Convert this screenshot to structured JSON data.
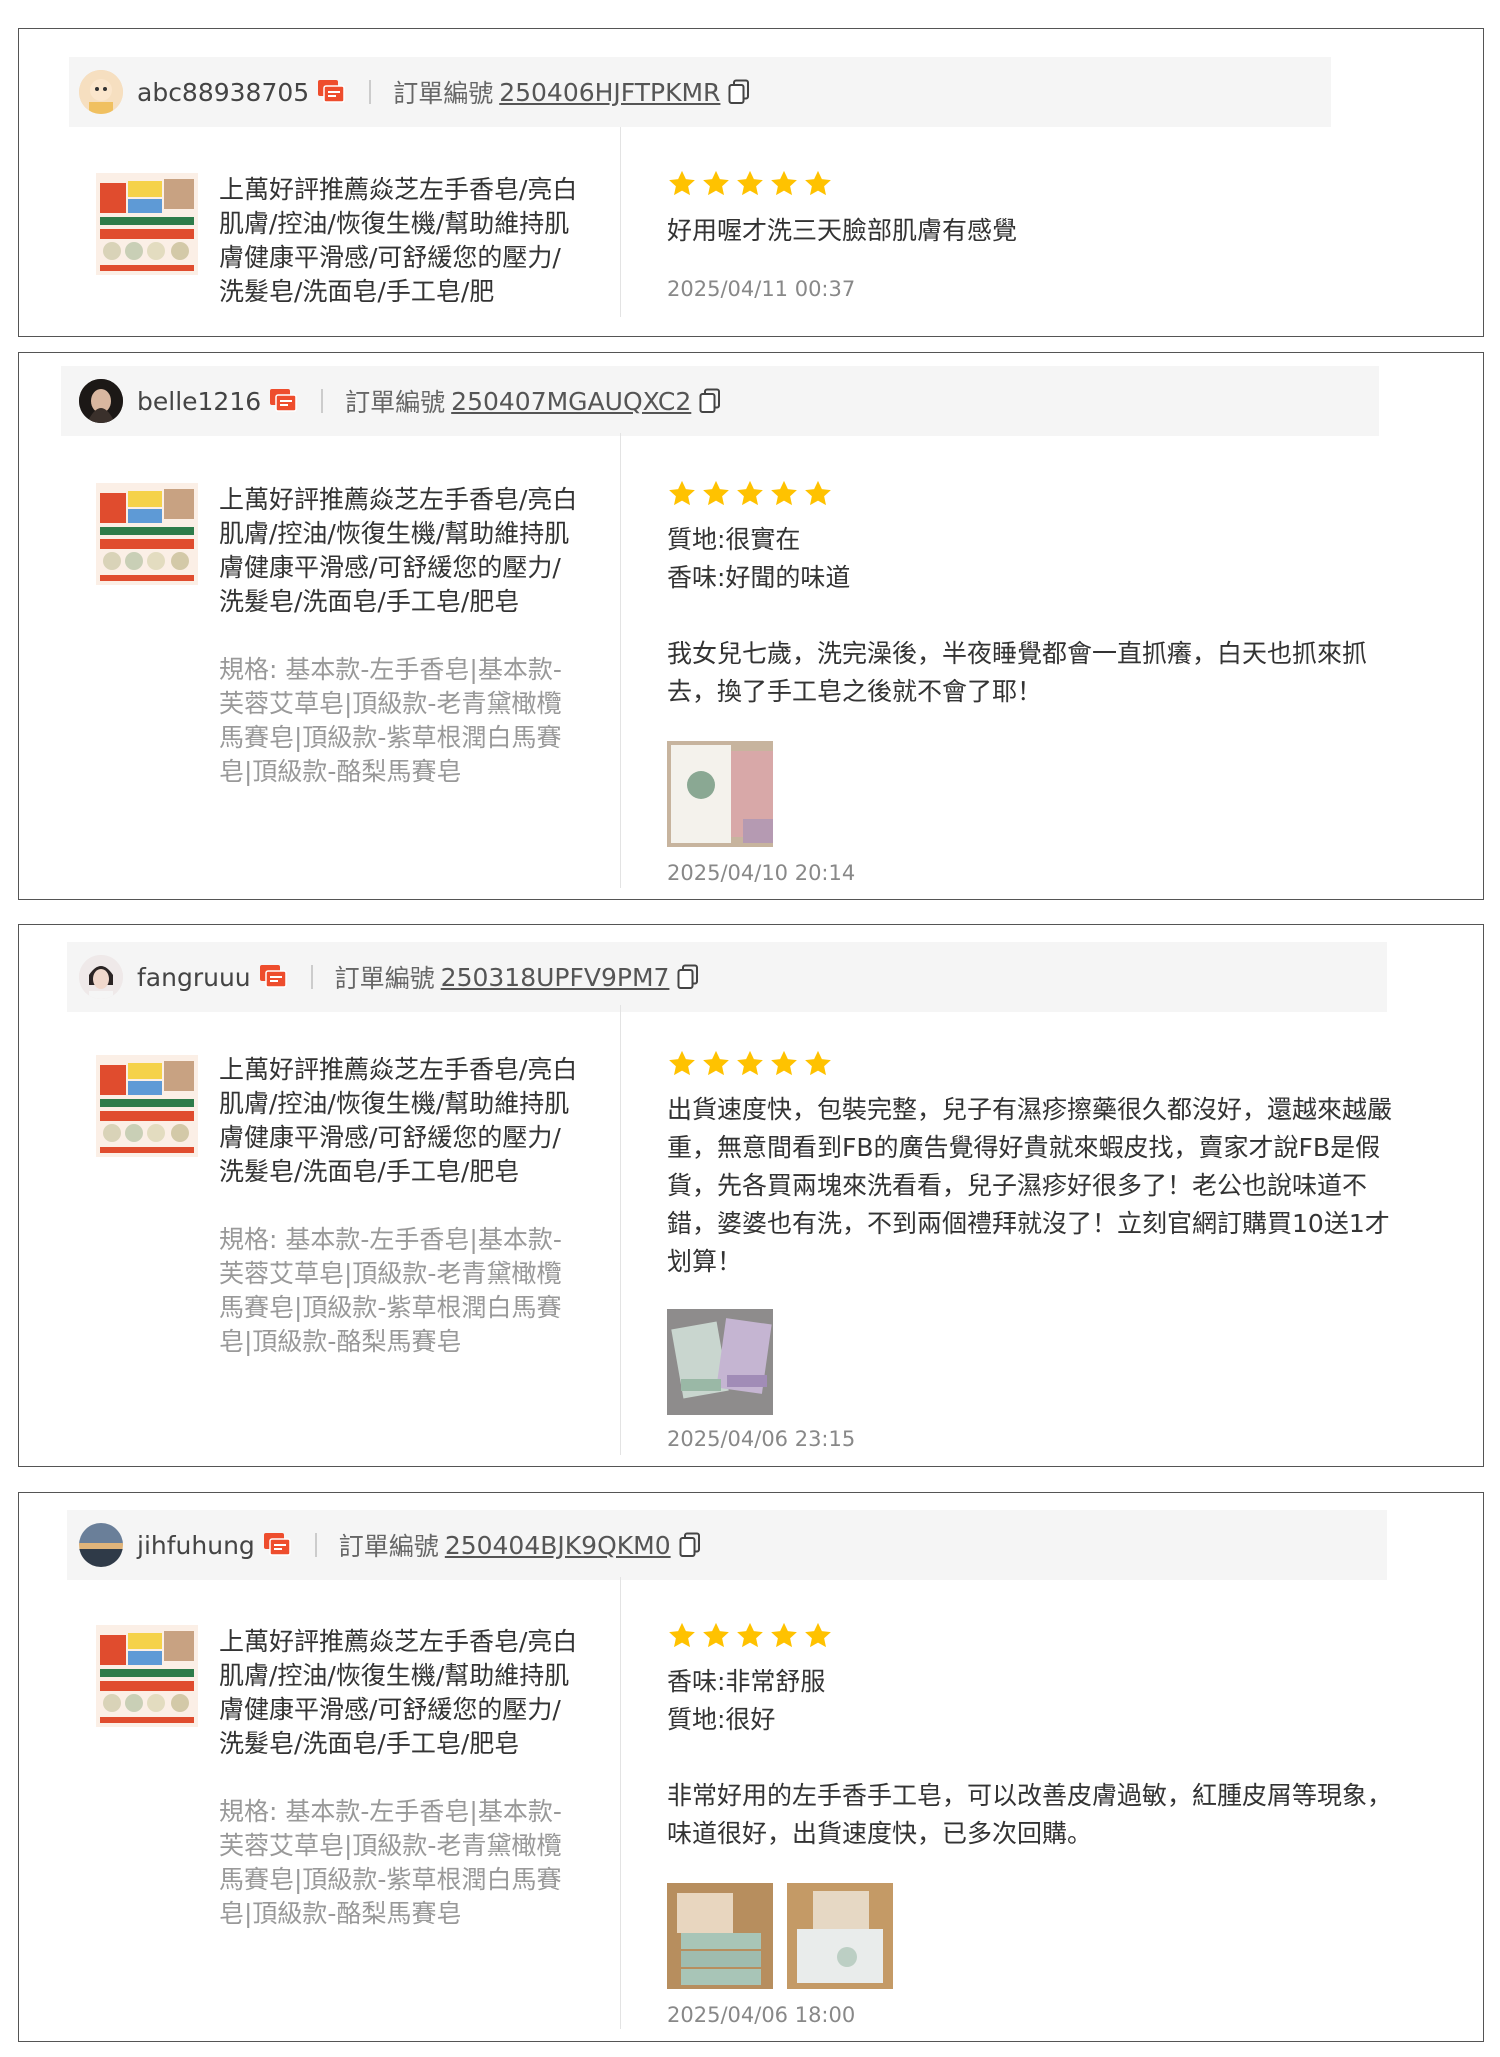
{
  "colors": {
    "star": "#FFC200",
    "chat_icon": "#EE4D2D",
    "header_bg": "#F5F5F5"
  },
  "reviews": [
    {
      "username": "abc88938705",
      "order_label": "訂單編號",
      "order_no": "250406HJFTPKMR",
      "product_name": "上萬好評推薦焱芝左手香皂/亮白肌膚/控油/恢復生機/幫助維持肌膚健康平滑感/可舒緩您的壓力/洗髮皂/洗面皂/手工皂/肥",
      "spec": "",
      "rating": 5,
      "text": "好用喔才洗三天臉部肌膚有感覺",
      "photos": [],
      "date": "2025/04/11 00:37"
    },
    {
      "username": "belle1216",
      "order_label": "訂單編號",
      "order_no": "250407MGAUQXC2",
      "product_name": "上萬好評推薦焱芝左手香皂/亮白肌膚/控油/恢復生機/幫助維持肌膚健康平滑感/可舒緩您的壓力/洗髮皂/洗面皂/手工皂/肥皂",
      "spec": "規格: 基本款-左手香皂|基本款-芙蓉艾草皂|頂級款-老青黛橄欖馬賽皂|頂級款-紫草根潤白馬賽皂|頂級款-酪梨馬賽皂",
      "rating": 5,
      "text": "質地:很實在\n香味:好聞的味道\n\n我女兒七歲，洗完澡後，半夜睡覺都會一直抓癢，白天也抓來抓去，換了手工皂之後就不會了耶！",
      "photos": [
        "photo-card"
      ],
      "date": "2025/04/10 20:14"
    },
    {
      "username": "fangruuu",
      "order_label": "訂單編號",
      "order_no": "250318UPFV9PM7",
      "product_name": "上萬好評推薦焱芝左手香皂/亮白肌膚/控油/恢復生機/幫助維持肌膚健康平滑感/可舒緩您的壓力/洗髮皂/洗面皂/手工皂/肥皂",
      "spec": "規格: 基本款-左手香皂|基本款-芙蓉艾草皂|頂級款-老青黛橄欖馬賽皂|頂級款-紫草根潤白馬賽皂|頂級款-酪梨馬賽皂",
      "rating": 5,
      "text": "出貨速度快，包裝完整，兒子有濕疹擦藥很久都沒好，還越來越嚴重，無意間看到FB的廣告覺得好貴就來蝦皮找，賣家才說FB是假貨，先各買兩塊來洗看看，兒子濕疹好很多了！老公也說味道不錯，婆婆也有洗，不到兩個禮拜就沒了！立刻官網訂購買10送1才划算！",
      "photos": [
        "photo-soaps"
      ],
      "date": "2025/04/06 23:15"
    },
    {
      "username": "jihfuhung",
      "order_label": "訂單編號",
      "order_no": "250404BJK9QKM0",
      "product_name": "上萬好評推薦焱芝左手香皂/亮白肌膚/控油/恢復生機/幫助維持肌膚健康平滑感/可舒緩您的壓力/洗髮皂/洗面皂/手工皂/肥皂",
      "spec": "規格: 基本款-左手香皂|基本款-芙蓉艾草皂|頂級款-老青黛橄欖馬賽皂|頂級款-紫草根潤白馬賽皂|頂級款-酪梨馬賽皂",
      "rating": 5,
      "text": "香味:非常舒服\n質地:很好\n\n非常好用的左手香手工皂，可以改善皮膚過敏，紅腫皮屑等現象，味道很好，出貨速度快，已多次回購。",
      "photos": [
        "photo-box-1",
        "photo-box-2"
      ],
      "date": "2025/04/06 18:00"
    }
  ]
}
